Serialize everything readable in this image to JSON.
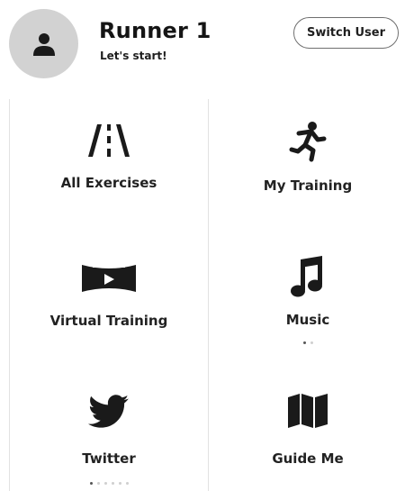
{
  "header": {
    "user_name": "Runner 1",
    "subtitle": "Let's start!",
    "switch_user_label": "Switch User",
    "avatar_icon": "user-silhouette-icon"
  },
  "menu": {
    "items": [
      {
        "label": "All Exercises",
        "icon": "road-icon"
      },
      {
        "label": "My Training",
        "icon": "running-person-icon"
      },
      {
        "label": "Virtual Training",
        "icon": "panorama-video-icon"
      },
      {
        "label": "Music",
        "icon": "music-note-icon",
        "page_dots": {
          "count": 2,
          "active": 1
        }
      },
      {
        "label": "Twitter",
        "icon": "twitter-bird-icon",
        "page_dots": {
          "count": 6,
          "active": 1
        }
      },
      {
        "label": "Guide Me",
        "icon": "map-icon"
      }
    ]
  },
  "colors": {
    "avatar_bg": "#d2d2d2",
    "icon": "#1a1a1a",
    "divider": "#e2e2e2",
    "dot_active": "#555555",
    "dot_inactive": "#cfcfcf"
  }
}
